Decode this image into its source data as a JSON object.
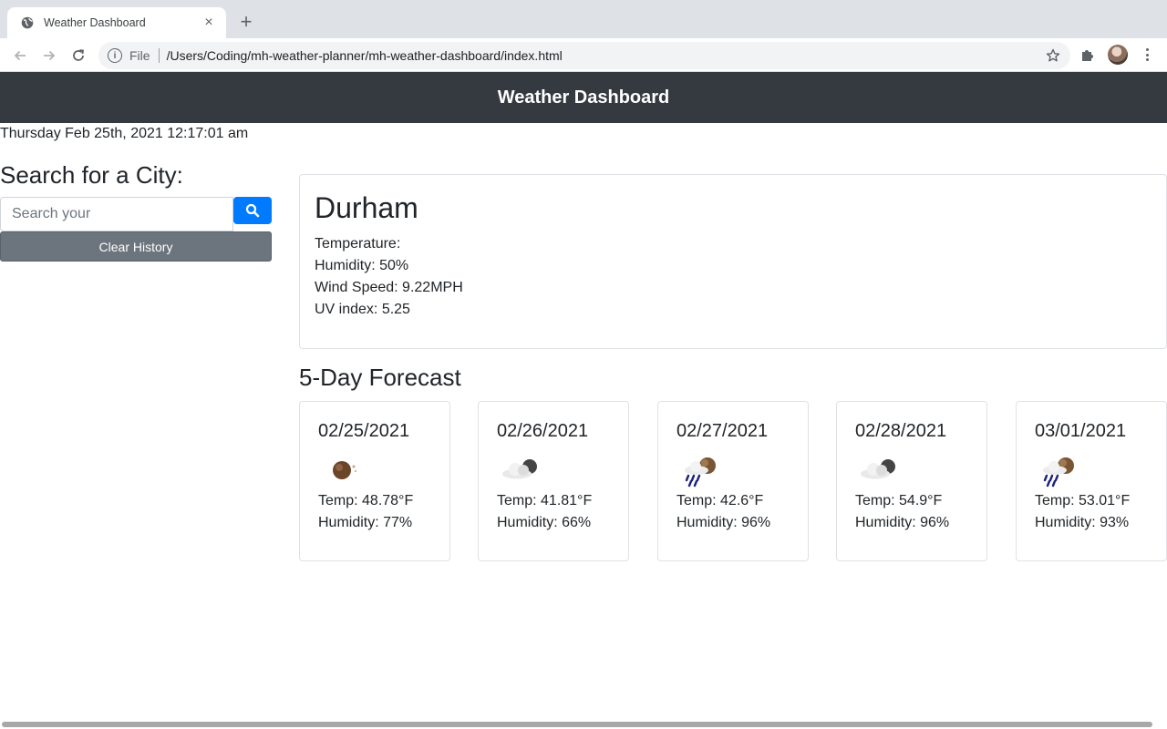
{
  "browser": {
    "tab_title": "Weather Dashboard",
    "tab_close": "×",
    "new_tab": "+",
    "scheme": "File",
    "url": "/Users/Coding/mh-weather-planner/mh-weather-dashboard/index.html"
  },
  "header": {
    "title": "Weather Dashboard"
  },
  "datetime": "Thursday Feb 25th, 2021 12:17:01 am",
  "search": {
    "heading": "Search for a City:",
    "placeholder": "Search your",
    "clear_label": "Clear History"
  },
  "current": {
    "city": "Durham",
    "temperature": "Temperature:",
    "humidity": "Humidity: 50%",
    "wind": "Wind Speed: 9.22MPH",
    "uv": "UV index: 5.25"
  },
  "forecast": {
    "heading": "5-Day Forecast",
    "days": [
      {
        "date": "02/25/2021",
        "icon": "clear-night-icon",
        "temp": "Temp: 48.78°F",
        "humidity": "Humidity: 77%"
      },
      {
        "date": "02/26/2021",
        "icon": "cloudy-night-icon",
        "temp": "Temp: 41.81°F",
        "humidity": "Humidity: 66%"
      },
      {
        "date": "02/27/2021",
        "icon": "rain-night-icon",
        "temp": "Temp: 42.6°F",
        "humidity": "Humidity: 96%"
      },
      {
        "date": "02/28/2021",
        "icon": "cloudy-night-icon",
        "temp": "Temp: 54.9°F",
        "humidity": "Humidity: 96%"
      },
      {
        "date": "03/01/2021",
        "icon": "rain-night-icon",
        "temp": "Temp: 53.01°F",
        "humidity": "Humidity: 93%"
      }
    ]
  },
  "colors": {
    "header_bg": "#343a40",
    "primary": "#007bff",
    "secondary": "#6c757d"
  }
}
